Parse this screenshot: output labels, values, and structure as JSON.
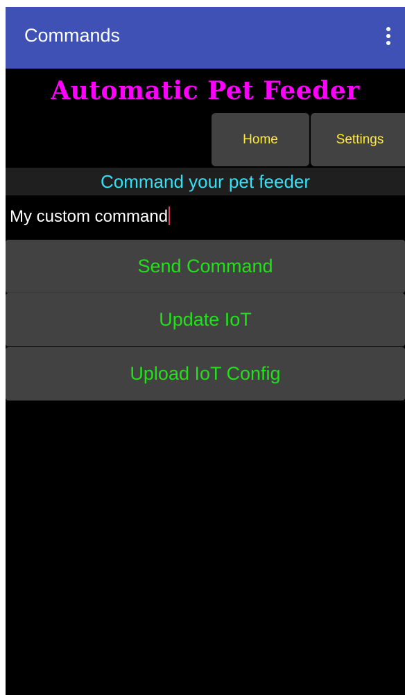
{
  "appbar": {
    "title": "Commands",
    "menu_icon": "more-vert-icon"
  },
  "banner": {
    "title": "Automatic Pet Feeder",
    "color": "#ff00ff"
  },
  "nav": {
    "home_label": "Home",
    "settings_label": "Settings"
  },
  "subtitle": "Command your pet feeder",
  "command_input": {
    "value": "My custom command"
  },
  "actions": {
    "send_label": "Send Command",
    "update_label": "Update IoT",
    "upload_label": "Upload IoT Config"
  },
  "colors": {
    "appbar": "#3f51b5",
    "nav_text": "#ffeb3b",
    "subtitle_text": "#33e0f5",
    "action_text": "#22e01a",
    "button_bg": "#424242"
  }
}
